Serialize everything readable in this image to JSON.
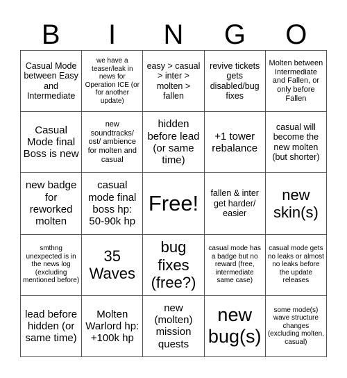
{
  "header": {
    "letters": [
      "B",
      "I",
      "N",
      "G",
      "O"
    ]
  },
  "cells": [
    "Casual Mode between Easy and Intermediate",
    "we have a teaser/leak in news for Operation ICE (or for another update)",
    "easy > casual > inter > molten > fallen",
    "revive tickets gets disabled/bug fixes",
    "Molten between Intermediate and Fallen, or only before Fallen",
    "Casual Mode final Boss is new",
    "new soundtracks/ ost/ ambience for molten and casual",
    "hidden before lead (or same time)",
    "+1 tower rebalance",
    "casual will become the new molten (but shorter)",
    "new badge for reworked molten",
    "casual mode final boss hp: 50-90k hp",
    "Free!",
    "fallen & inter get harder/ easier",
    "new skin(s)",
    "smthng unexpected is in the news log (excluding mentioned before)",
    "35 Waves",
    "bug fixes (free?)",
    "casual mode has a badge but no reward (free, intermediate same case)",
    "casual mode gets no leaks or almost no leaks before the update releases",
    "lead before hidden (or same time)",
    "Molten Warlord hp: +100k hp",
    "new (molten) mission quests",
    "new bug(s)",
    "some mode(s) wave structure changes (excluding molten, casual)"
  ]
}
